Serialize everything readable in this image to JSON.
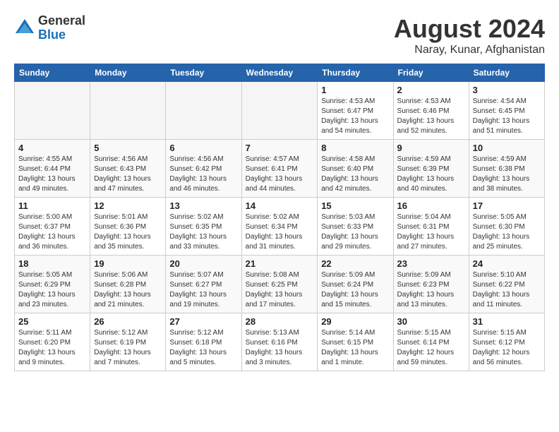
{
  "logo": {
    "general": "General",
    "blue": "Blue"
  },
  "title": "August 2024",
  "location": "Naray, Kunar, Afghanistan",
  "days_of_week": [
    "Sunday",
    "Monday",
    "Tuesday",
    "Wednesday",
    "Thursday",
    "Friday",
    "Saturday"
  ],
  "weeks": [
    [
      {
        "num": "",
        "info": ""
      },
      {
        "num": "",
        "info": ""
      },
      {
        "num": "",
        "info": ""
      },
      {
        "num": "",
        "info": ""
      },
      {
        "num": "1",
        "info": "Sunrise: 4:53 AM\nSunset: 6:47 PM\nDaylight: 13 hours\nand 54 minutes."
      },
      {
        "num": "2",
        "info": "Sunrise: 4:53 AM\nSunset: 6:46 PM\nDaylight: 13 hours\nand 52 minutes."
      },
      {
        "num": "3",
        "info": "Sunrise: 4:54 AM\nSunset: 6:45 PM\nDaylight: 13 hours\nand 51 minutes."
      }
    ],
    [
      {
        "num": "4",
        "info": "Sunrise: 4:55 AM\nSunset: 6:44 PM\nDaylight: 13 hours\nand 49 minutes."
      },
      {
        "num": "5",
        "info": "Sunrise: 4:56 AM\nSunset: 6:43 PM\nDaylight: 13 hours\nand 47 minutes."
      },
      {
        "num": "6",
        "info": "Sunrise: 4:56 AM\nSunset: 6:42 PM\nDaylight: 13 hours\nand 46 minutes."
      },
      {
        "num": "7",
        "info": "Sunrise: 4:57 AM\nSunset: 6:41 PM\nDaylight: 13 hours\nand 44 minutes."
      },
      {
        "num": "8",
        "info": "Sunrise: 4:58 AM\nSunset: 6:40 PM\nDaylight: 13 hours\nand 42 minutes."
      },
      {
        "num": "9",
        "info": "Sunrise: 4:59 AM\nSunset: 6:39 PM\nDaylight: 13 hours\nand 40 minutes."
      },
      {
        "num": "10",
        "info": "Sunrise: 4:59 AM\nSunset: 6:38 PM\nDaylight: 13 hours\nand 38 minutes."
      }
    ],
    [
      {
        "num": "11",
        "info": "Sunrise: 5:00 AM\nSunset: 6:37 PM\nDaylight: 13 hours\nand 36 minutes."
      },
      {
        "num": "12",
        "info": "Sunrise: 5:01 AM\nSunset: 6:36 PM\nDaylight: 13 hours\nand 35 minutes."
      },
      {
        "num": "13",
        "info": "Sunrise: 5:02 AM\nSunset: 6:35 PM\nDaylight: 13 hours\nand 33 minutes."
      },
      {
        "num": "14",
        "info": "Sunrise: 5:02 AM\nSunset: 6:34 PM\nDaylight: 13 hours\nand 31 minutes."
      },
      {
        "num": "15",
        "info": "Sunrise: 5:03 AM\nSunset: 6:33 PM\nDaylight: 13 hours\nand 29 minutes."
      },
      {
        "num": "16",
        "info": "Sunrise: 5:04 AM\nSunset: 6:31 PM\nDaylight: 13 hours\nand 27 minutes."
      },
      {
        "num": "17",
        "info": "Sunrise: 5:05 AM\nSunset: 6:30 PM\nDaylight: 13 hours\nand 25 minutes."
      }
    ],
    [
      {
        "num": "18",
        "info": "Sunrise: 5:05 AM\nSunset: 6:29 PM\nDaylight: 13 hours\nand 23 minutes."
      },
      {
        "num": "19",
        "info": "Sunrise: 5:06 AM\nSunset: 6:28 PM\nDaylight: 13 hours\nand 21 minutes."
      },
      {
        "num": "20",
        "info": "Sunrise: 5:07 AM\nSunset: 6:27 PM\nDaylight: 13 hours\nand 19 minutes."
      },
      {
        "num": "21",
        "info": "Sunrise: 5:08 AM\nSunset: 6:25 PM\nDaylight: 13 hours\nand 17 minutes."
      },
      {
        "num": "22",
        "info": "Sunrise: 5:09 AM\nSunset: 6:24 PM\nDaylight: 13 hours\nand 15 minutes."
      },
      {
        "num": "23",
        "info": "Sunrise: 5:09 AM\nSunset: 6:23 PM\nDaylight: 13 hours\nand 13 minutes."
      },
      {
        "num": "24",
        "info": "Sunrise: 5:10 AM\nSunset: 6:22 PM\nDaylight: 13 hours\nand 11 minutes."
      }
    ],
    [
      {
        "num": "25",
        "info": "Sunrise: 5:11 AM\nSunset: 6:20 PM\nDaylight: 13 hours\nand 9 minutes."
      },
      {
        "num": "26",
        "info": "Sunrise: 5:12 AM\nSunset: 6:19 PM\nDaylight: 13 hours\nand 7 minutes."
      },
      {
        "num": "27",
        "info": "Sunrise: 5:12 AM\nSunset: 6:18 PM\nDaylight: 13 hours\nand 5 minutes."
      },
      {
        "num": "28",
        "info": "Sunrise: 5:13 AM\nSunset: 6:16 PM\nDaylight: 13 hours\nand 3 minutes."
      },
      {
        "num": "29",
        "info": "Sunrise: 5:14 AM\nSunset: 6:15 PM\nDaylight: 13 hours\nand 1 minute."
      },
      {
        "num": "30",
        "info": "Sunrise: 5:15 AM\nSunset: 6:14 PM\nDaylight: 12 hours\nand 59 minutes."
      },
      {
        "num": "31",
        "info": "Sunrise: 5:15 AM\nSunset: 6:12 PM\nDaylight: 12 hours\nand 56 minutes."
      }
    ]
  ]
}
